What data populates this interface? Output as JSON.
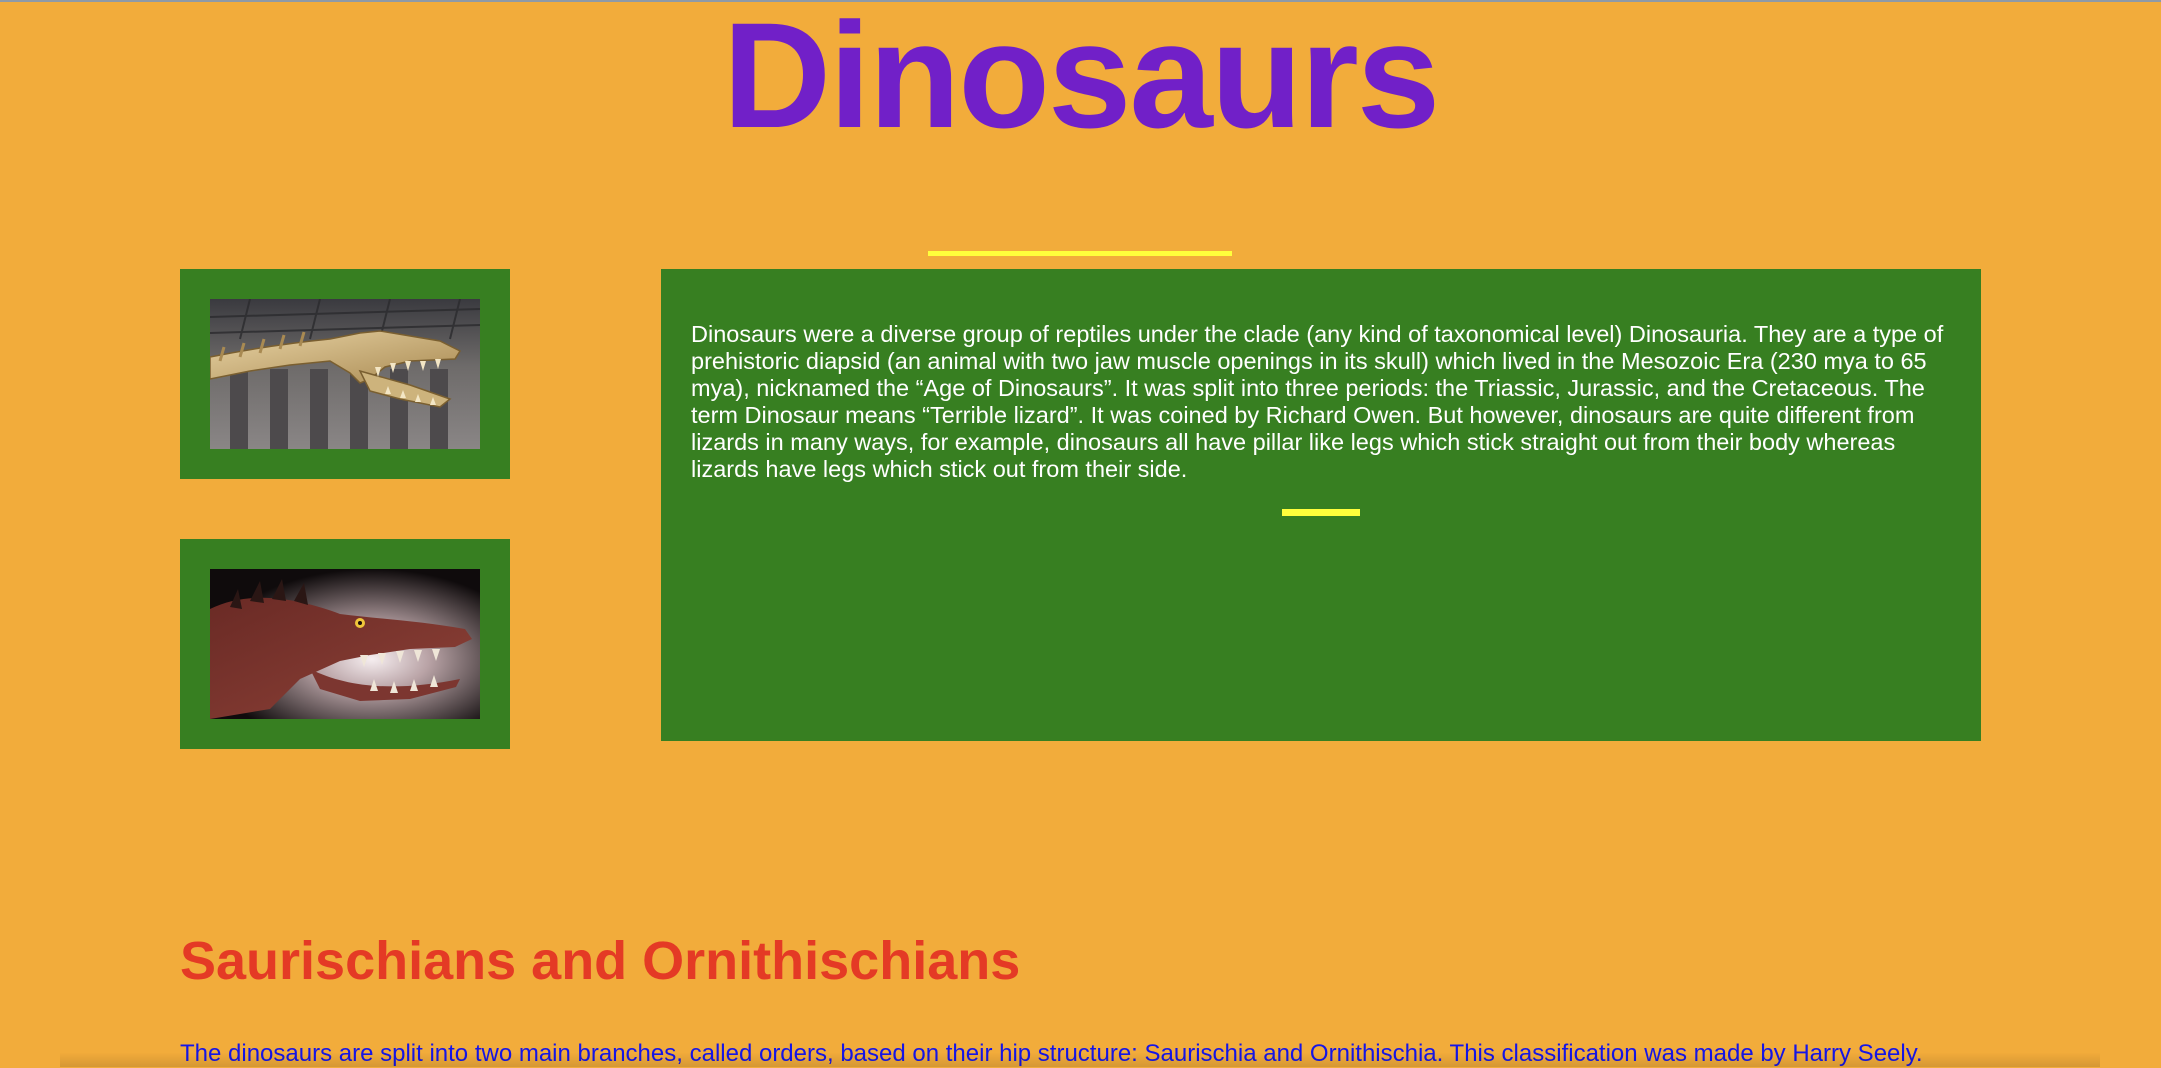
{
  "header": {
    "title": "Dinosaurs"
  },
  "intro": {
    "paragraph": "Dinosaurs were a diverse group of reptiles under the clade (any kind of taxonomical level) Dinosauria. They are a type of prehistoric diapsid (an animal with two jaw muscle openings in its skull) which lived in the Mesozoic Era (230 mya to 65 mya), nicknamed the “Age of Dinosaurs”. It was split into three periods: the Triassic, Jurassic, and the Cretaceous. The term Dinosaur means “Terrible lizard”. It was coined by Richard Owen. But however, dinosaurs are quite different from lizards in many ways, for example, dinosaurs all have pillar like legs which stick straight out from their body whereas lizards have legs which stick out from their side."
  },
  "section": {
    "heading": "Saurischians and Ornithischians",
    "paragraph": "The dinosaurs are split into two main branches, called orders, based on their hip structure: Saurischia and Ornithischia. This classification was made by Harry Seely."
  },
  "colors": {
    "page_background": "#f2ac3b",
    "title": "#7120c8",
    "panel": "#377f21",
    "accent_line": "#ffff3c",
    "section_heading": "#e43a25",
    "section_text": "#1515e8"
  },
  "images": [
    {
      "icon": "dinosaur-skeleton-photo"
    },
    {
      "icon": "dinosaur-head-illustration"
    }
  ]
}
